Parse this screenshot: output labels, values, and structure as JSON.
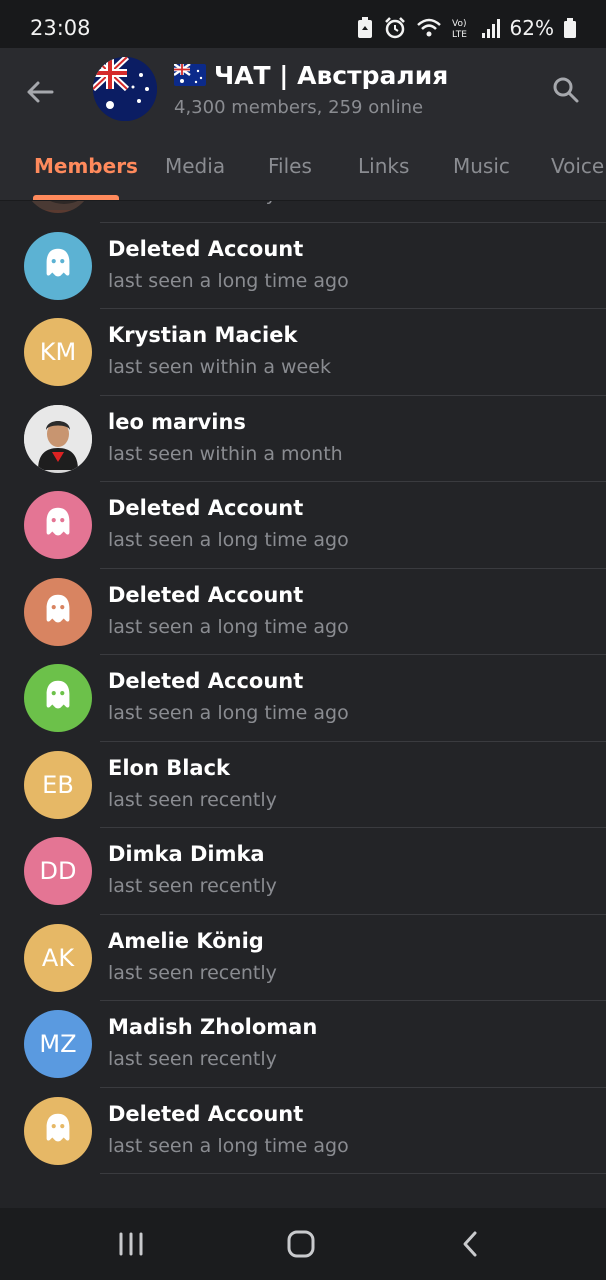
{
  "statusbar": {
    "time": "23:08",
    "battery": "62%"
  },
  "header": {
    "title": "ЧАТ | Австралия",
    "subtitle": "4,300 members, 259 online"
  },
  "tabs": [
    "Members",
    "Media",
    "Files",
    "Links",
    "Music",
    "Voice"
  ],
  "members": [
    {
      "name": "",
      "status": "last seen recently",
      "avatar_type": "photo",
      "color": "#5a3a30"
    },
    {
      "name": "Deleted Account",
      "status": "last seen a long time ago",
      "avatar_type": "ghost",
      "color": "#5cb2d3"
    },
    {
      "name": "Krystian Maciek",
      "status": "last seen within a week",
      "avatar_type": "initials",
      "initials": "KM",
      "color": "#e6b866"
    },
    {
      "name": "leo marvins",
      "status": "last seen within a month",
      "avatar_type": "photo",
      "color": "#d9d9d9"
    },
    {
      "name": "Deleted Account",
      "status": "last seen a long time ago",
      "avatar_type": "ghost",
      "color": "#e47594"
    },
    {
      "name": "Deleted Account",
      "status": "last seen a long time ago",
      "avatar_type": "ghost",
      "color": "#d88461"
    },
    {
      "name": "Deleted Account",
      "status": "last seen a long time ago",
      "avatar_type": "ghost",
      "color": "#6cc14a"
    },
    {
      "name": "Elon Black",
      "status": "last seen recently",
      "avatar_type": "initials",
      "initials": "EB",
      "color": "#e6b866"
    },
    {
      "name": "Dimka Dimka",
      "status": "last seen recently",
      "avatar_type": "initials",
      "initials": "DD",
      "color": "#e47594"
    },
    {
      "name": "Amelie König",
      "status": "last seen recently",
      "avatar_type": "initials",
      "initials": "AK",
      "color": "#e6b866"
    },
    {
      "name": "Madish Zholoman",
      "status": "last seen recently",
      "avatar_type": "initials",
      "initials": "MZ",
      "color": "#5a9ae0"
    },
    {
      "name": "Deleted Account",
      "status": "last seen a long time ago",
      "avatar_type": "ghost",
      "color": "#e6b866"
    }
  ],
  "colors": {
    "accent": "#ff8a5c",
    "background": "#232427",
    "header": "#2a2b2f"
  }
}
